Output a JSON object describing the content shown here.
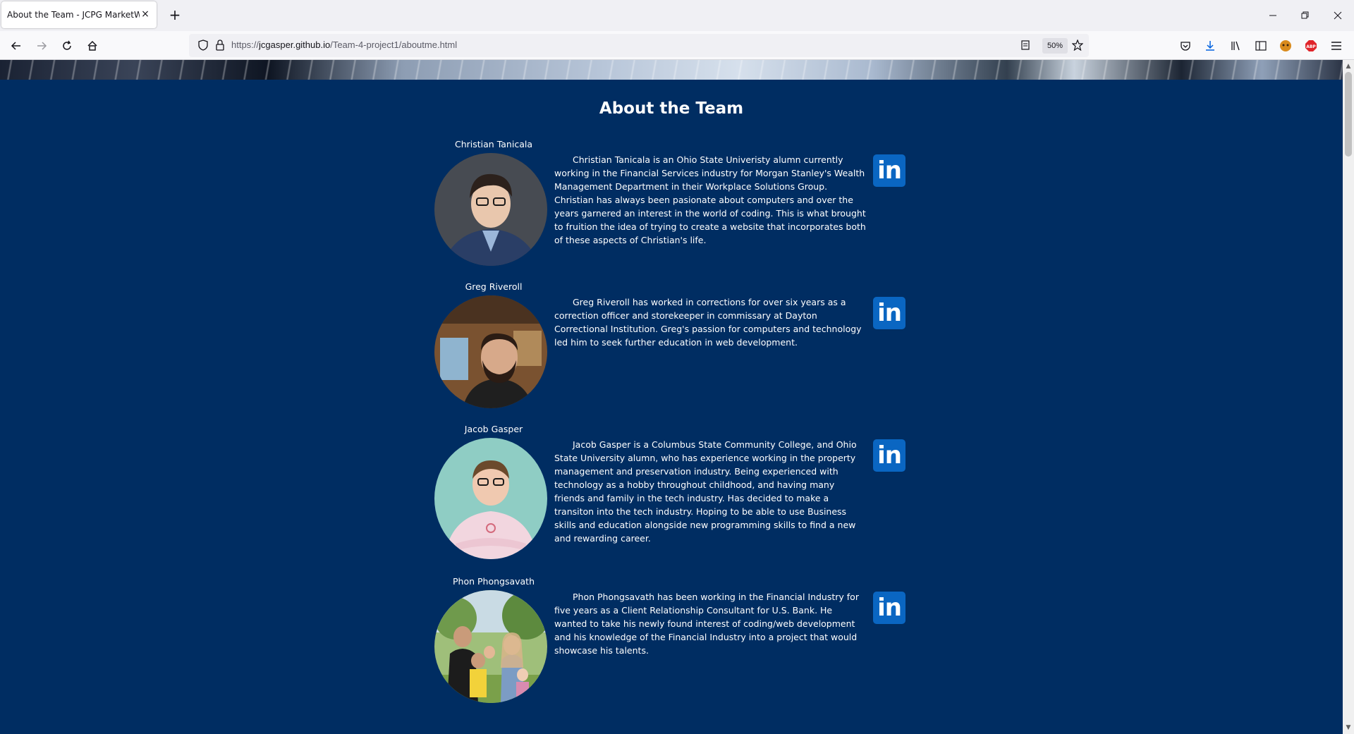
{
  "browser": {
    "tab_title": "About the Team - JCPG MarketWatch",
    "tab_close": "×",
    "new_tab": "+",
    "url_prefix": "https://",
    "url_host": "jcgasper.github.io",
    "url_path": "/Team-4-project1/aboutme.html",
    "zoom": "50%"
  },
  "page": {
    "title": "About the Team",
    "members": [
      {
        "name": "Christian Tanicala",
        "bio": "Christian Tanicala is an Ohio State Univeristy alumn currently working in the Financial Services industry for Morgan Stanley's Wealth Management Department in their Workplace Solutions Group. Christian has always been pasionate about computers and over the years garnered an interest in the world of coding. This is what brought to fruition the idea of trying to create a website that incorporates both of these aspects of Christian's life.",
        "linkedin": "in"
      },
      {
        "name": "Greg Riveroll",
        "bio": "Greg Riveroll has worked in corrections for over six years as a correction officer and storekeeper in commissary at Dayton Correctional Institution. Greg's passion for computers and technology led him to seek further education in web development.",
        "linkedin": "in"
      },
      {
        "name": "Jacob Gasper",
        "bio": "Jacob Gasper is a Columbus State Community College, and Ohio State University alumn, who has experience working in the property management and preservation industry. Being experienced with technology as a hobby throughout childhood, and having many friends and family in the tech industry. Has decided to make a transiton into the tech industry. Hoping to be able to use Business skills and education alongside new programming skills to find a new and rewarding career.",
        "linkedin": "in"
      },
      {
        "name": "Phon Phongsavath",
        "bio": "Phon Phongsavath has been working in the Financial Industry for five years as a Client Relationship Consultant for U.S. Bank. He wanted to take his newly found interest of coding/web development and his knowledge of the Financial Industry into a project that would showcase his talents.",
        "linkedin": "in"
      }
    ]
  },
  "colors": {
    "page_bg": "#002d62",
    "linkedin_blue": "#0a66c2",
    "text": "#ffffff"
  },
  "icons": [
    "back-icon",
    "forward-icon",
    "reload-icon",
    "home-icon",
    "shield-icon",
    "lock-icon",
    "reader-view-icon",
    "bookmark-star-icon",
    "pocket-icon",
    "download-icon",
    "library-icon",
    "sidebar-icon",
    "extension-icon",
    "adblock-icon",
    "menu-icon"
  ]
}
